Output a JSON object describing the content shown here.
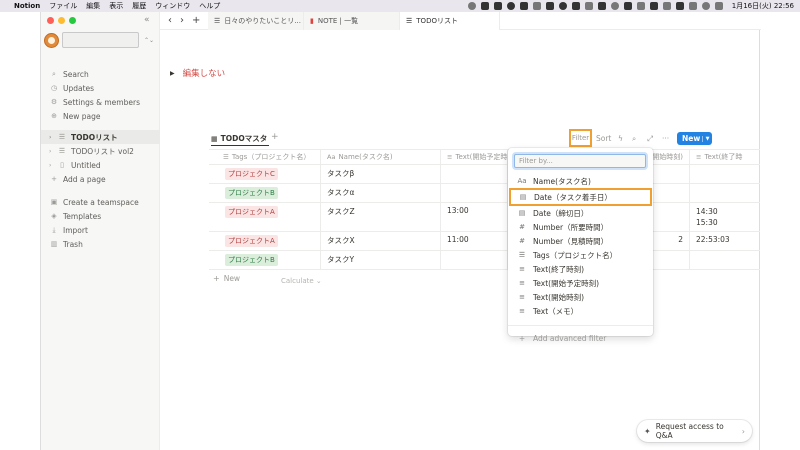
{
  "menubar": {
    "app": "Notion",
    "items": [
      "ファイル",
      "編集",
      "表示",
      "履歴",
      "ウィンドウ",
      "ヘルプ"
    ],
    "datetime": "1月16日(火) 22:56"
  },
  "sidebar": {
    "search": "Search",
    "updates": "Updates",
    "settings": "Settings & members",
    "new_page": "New page",
    "pages": [
      "TODOリスト",
      "TODOリスト vol2",
      "Untitled"
    ],
    "add_page": "Add a page",
    "create_teamspace": "Create a teamspace",
    "templates": "Templates",
    "import": "Import",
    "trash": "Trash"
  },
  "tabs": [
    {
      "label": "日々のやりたいことリ..."
    },
    {
      "label": "NOTE | 一覧"
    },
    {
      "label": "TODOリスト"
    }
  ],
  "toggle_label": "編集しない",
  "view": {
    "tab_label": "TODOマスタ",
    "filter": "Filter",
    "sort": "Sort",
    "new": "New"
  },
  "table": {
    "columns": [
      "Tags（プロジェクト名）",
      "Name(タスク名)",
      "Text(開始予定時",
      "開始時刻)",
      "Text(終了時"
    ],
    "rows": [
      {
        "tag": "プロジェクトC",
        "tag_kind": "c",
        "name": "タスクβ",
        "start_plan": "",
        "start": "",
        "end": ""
      },
      {
        "tag": "プロジェクトB",
        "tag_kind": "b",
        "name": "タスクα",
        "start_plan": "",
        "start": "",
        "end": ""
      },
      {
        "tag": "プロジェクトA",
        "tag_kind": "a",
        "name": "タスクZ",
        "start_plan": "13:00",
        "start": "",
        "end": "14:30",
        "end2": "15:30"
      },
      {
        "tag": "プロジェクトA",
        "tag_kind": "a",
        "name": "タスクX",
        "start_plan": "11:00",
        "start": "2",
        "end": "22:53:03"
      },
      {
        "tag": "プロジェクトB",
        "tag_kind": "b",
        "name": "タスクY",
        "start_plan": "",
        "start": "",
        "end": ""
      }
    ],
    "new_row": "New",
    "calculate": "Calculate"
  },
  "filter_menu": {
    "placeholder": "Filter by...",
    "items": [
      {
        "icon": "Aa",
        "label": "Name(タスク名)"
      },
      {
        "icon": "cal",
        "label": "Date（タスク着手日）"
      },
      {
        "icon": "cal",
        "label": "Date（締切日）"
      },
      {
        "icon": "#",
        "label": "Number（所要時間）"
      },
      {
        "icon": "#",
        "label": "Number（見積時間）"
      },
      {
        "icon": "tag",
        "label": "Tags（プロジェクト名）"
      },
      {
        "icon": "txt",
        "label": "Text(終了時刻)"
      },
      {
        "icon": "txt",
        "label": "Text(開始予定時刻)"
      },
      {
        "icon": "txt",
        "label": "Text(開始時刻)"
      },
      {
        "icon": "txt",
        "label": "Text（メモ）"
      }
    ],
    "add_advanced": "Add advanced filter"
  },
  "qa_button": "Request access to Q&A"
}
